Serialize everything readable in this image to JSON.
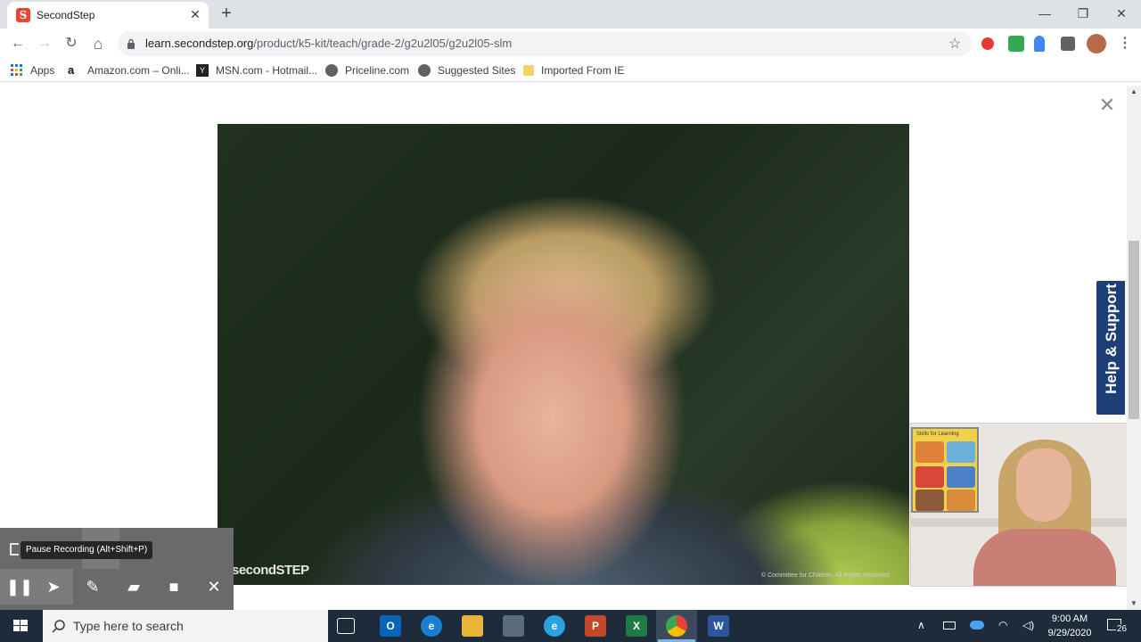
{
  "browser": {
    "tab": {
      "title": "SecondStep",
      "favicon_letter": "S"
    },
    "new_tab_label": "+",
    "window_controls": {
      "minimize": "—",
      "restore": "❐",
      "close": "✕"
    },
    "nav": {
      "back": "←",
      "forward": "→",
      "reload": "↻",
      "home": "⌂"
    },
    "url_host": "learn.secondstep.org",
    "url_path": "/product/k5-kit/teach/grade-2/g2u2l05/g2u2l05-slm",
    "bookmark_star": "☆",
    "bookmarks": [
      {
        "label": "Apps",
        "icon": "apps-grid-icon"
      },
      {
        "label": "Amazon.com – Onli...",
        "icon": "amazon-icon"
      },
      {
        "label": "MSN.com - Hotmail...",
        "icon": "msn-icon"
      },
      {
        "label": "Priceline.com",
        "icon": "globe-icon"
      },
      {
        "label": "Suggested Sites",
        "icon": "globe-icon"
      },
      {
        "label": "Imported From IE",
        "icon": "folder-icon"
      }
    ]
  },
  "page": {
    "close_symbol": "✕",
    "video_watermark": "secondSTEP",
    "video_copyright": "© Committee for Children, All Rights Reserved",
    "help_tab_label": "Help & Support",
    "poster_title": "Skills for Learning"
  },
  "recorder": {
    "tooltip": "Pause Recording (Alt+Shift+P)",
    "buttons": [
      {
        "name": "pause-recording-button",
        "glyph": "❚❚"
      },
      {
        "name": "pointer-tool-button",
        "glyph": "➤"
      },
      {
        "name": "pen-tool-button",
        "glyph": "✎"
      },
      {
        "name": "eraser-tool-button",
        "glyph": "▰"
      },
      {
        "name": "webcam-toggle-button",
        "glyph": "■"
      },
      {
        "name": "close-recorder-button",
        "glyph": "✕"
      }
    ]
  },
  "taskbar": {
    "search_placeholder": "Type here to search",
    "time": "9:00 AM",
    "date": "9/29/2020",
    "notification_count": "26",
    "apps": [
      {
        "name": "task-view",
        "label": "⧉",
        "color": "#1d2b3a"
      },
      {
        "name": "outlook",
        "label": "O",
        "color": "#0a64b8"
      },
      {
        "name": "edge",
        "label": "e",
        "color": "#1a7fd4"
      },
      {
        "name": "file-explorer",
        "label": "▬",
        "color": "#e8b53a"
      },
      {
        "name": "store",
        "label": "▣",
        "color": "#5a6b7d"
      },
      {
        "name": "internet-explorer",
        "label": "e",
        "color": "#2aa2e0"
      },
      {
        "name": "powerpoint",
        "label": "P",
        "color": "#c4472b"
      },
      {
        "name": "excel",
        "label": "X",
        "color": "#1f7a43"
      },
      {
        "name": "chrome",
        "label": "◉",
        "color": "#2d8c3c"
      },
      {
        "name": "word",
        "label": "W",
        "color": "#2b579a"
      }
    ]
  },
  "colors": {
    "help_tab": "#1d3f78",
    "taskbar": "#1d2b3a",
    "recorder_panel": "#6a6a6a"
  }
}
